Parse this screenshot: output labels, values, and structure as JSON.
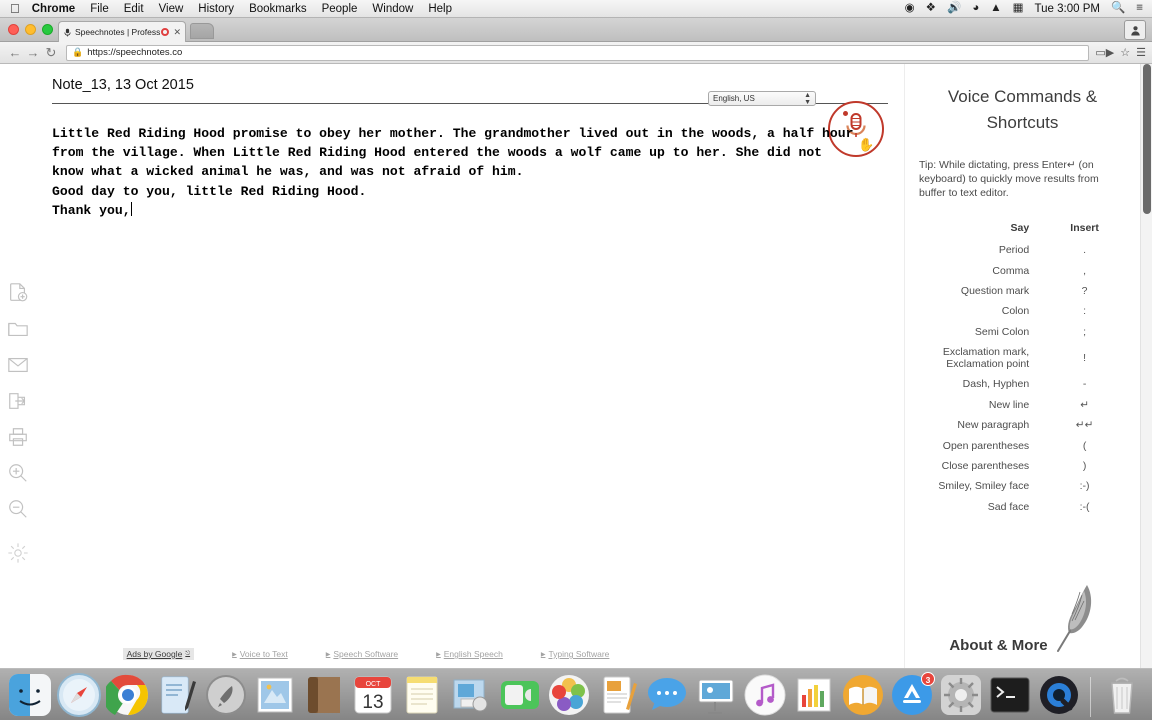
{
  "menubar": {
    "apple_icon": "apple-icon",
    "items": [
      "Chrome",
      "File",
      "Edit",
      "View",
      "History",
      "Bookmarks",
      "People",
      "Window",
      "Help"
    ],
    "status_icons": [
      "record-icon",
      "dropbox-icon",
      "volume-icon",
      "wifi-icon",
      "eject-icon",
      "display-icon"
    ],
    "clock": "Tue 3:00 PM",
    "search_icon": "search-icon",
    "notifications_icon": "notification-center-icon"
  },
  "browser": {
    "tab": {
      "favicon": "microphone-favicon",
      "title": "Speechnotes | Professi",
      "recording_indicator": "recording-dot-icon",
      "close_icon": "close-icon"
    },
    "new_tab_icon": "new-tab-icon",
    "profile_icon": "profile-icon",
    "back_icon": "back-arrow-icon",
    "forward_icon": "forward-arrow-icon",
    "reload_icon": "reload-icon",
    "lock_icon": "lock-icon",
    "url": "https://speechnotes.co",
    "cast_icon": "cast-icon",
    "bookmark_icon": "star-icon",
    "menu_icon": "hamburger-menu-icon"
  },
  "rail": {
    "items": [
      {
        "name": "new-note-icon",
        "label": "New note"
      },
      {
        "name": "open-folder-icon",
        "label": "Open"
      },
      {
        "name": "email-icon",
        "label": "Email"
      },
      {
        "name": "export-icon",
        "label": "Export"
      },
      {
        "name": "print-icon",
        "label": "Print"
      },
      {
        "name": "zoom-in-icon",
        "label": "Zoom in"
      },
      {
        "name": "zoom-out-icon",
        "label": "Zoom out"
      },
      {
        "name": "settings-gear-icon",
        "label": "Settings"
      }
    ]
  },
  "editor": {
    "note_title": "Note_13, 13 Oct 2015",
    "language_value": "English, US",
    "mic_icon": "microphone-icon",
    "cursor_icon": "hand-cursor-icon",
    "text_lines": [
      "Little Red Riding Hood promise to obey her mother. The grandmother lived out in the woods, a half hour",
      "from the village. When Little Red Riding Hood entered the woods a wolf came up to her. She did not",
      "know what a wicked animal he was, and was not afraid of him.",
      "Good day to you, little Red Riding Hood.",
      "Thank you,"
    ]
  },
  "ads": {
    "by_label": "Ads by Google",
    "by_icon": "external-link-icon",
    "links": [
      "Voice to Text",
      "Speech Software",
      "English Speech",
      "Typing Software"
    ]
  },
  "sidebar": {
    "title_line1": "Voice Commands &",
    "title_line2": "Shortcuts",
    "tip": "Tip: While dictating, press Enter↵ (on keyboard) to quickly move results from buffer to text editor.",
    "columns": {
      "say": "Say",
      "insert": "Insert"
    },
    "commands": [
      {
        "say": "Period",
        "insert": "."
      },
      {
        "say": "Comma",
        "insert": ","
      },
      {
        "say": "Question mark",
        "insert": "?"
      },
      {
        "say": "Colon",
        "insert": ":"
      },
      {
        "say": "Semi Colon",
        "insert": ";"
      },
      {
        "say": "Exclamation mark, Exclamation point",
        "insert": "!"
      },
      {
        "say": "Dash, Hyphen",
        "insert": "-"
      },
      {
        "say": "New line",
        "insert": "↵"
      },
      {
        "say": "New paragraph",
        "insert": "↵↵"
      },
      {
        "say": "Open parentheses",
        "insert": "("
      },
      {
        "say": "Close parentheses",
        "insert": ")"
      },
      {
        "say": "Smiley, Smiley face",
        "insert": ":-)"
      },
      {
        "say": "Sad face",
        "insert": ":-("
      }
    ],
    "about_label": "About & More",
    "about_icon": "feather-quill-icon"
  },
  "dock": {
    "apps": [
      {
        "name": "finder-icon",
        "label": "Finder"
      },
      {
        "name": "safari-icon",
        "label": "Safari"
      },
      {
        "name": "chrome-icon",
        "label": "Google Chrome"
      },
      {
        "name": "text-editor-icon",
        "label": "TextEdit"
      },
      {
        "name": "launchpad-icon",
        "label": "Launchpad"
      },
      {
        "name": "mail-icon",
        "label": "Mail"
      },
      {
        "name": "contacts-icon",
        "label": "Contacts"
      },
      {
        "name": "calendar-icon",
        "label": "Calendar",
        "month": "OCT",
        "day": "13"
      },
      {
        "name": "notes-icon",
        "label": "Notes"
      },
      {
        "name": "photo-booth-icon",
        "label": "Photo Booth"
      },
      {
        "name": "facetime-icon",
        "label": "FaceTime"
      },
      {
        "name": "photos-icon",
        "label": "Photos"
      },
      {
        "name": "pages-icon",
        "label": "Pages"
      },
      {
        "name": "messages-icon",
        "label": "Messages"
      },
      {
        "name": "keynote-icon",
        "label": "Keynote"
      },
      {
        "name": "itunes-icon",
        "label": "iTunes"
      },
      {
        "name": "numbers-icon",
        "label": "Numbers"
      },
      {
        "name": "ibooks-icon",
        "label": "iBooks"
      },
      {
        "name": "app-store-icon",
        "label": "App Store",
        "badge": "3"
      },
      {
        "name": "system-preferences-icon",
        "label": "System Preferences"
      },
      {
        "name": "terminal-icon",
        "label": "Terminal"
      },
      {
        "name": "quicktime-icon",
        "label": "QuickTime Player"
      },
      {
        "name": "trash-icon",
        "label": "Trash"
      }
    ]
  },
  "colors": {
    "accent_red": "#c0392b",
    "link_gray": "#a3a3a3",
    "text": "#000000"
  }
}
